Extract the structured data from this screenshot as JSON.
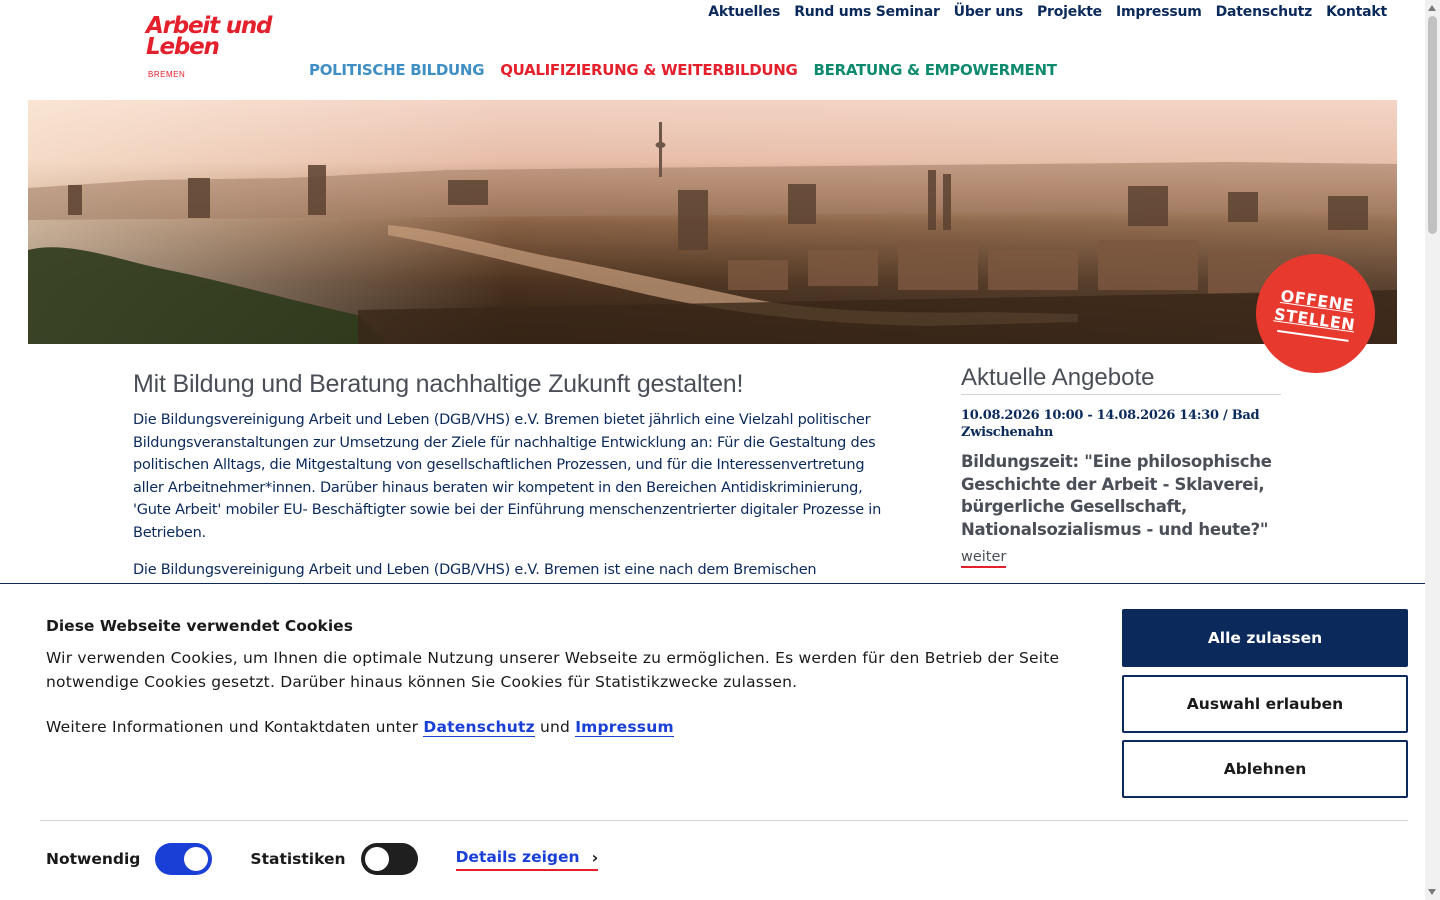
{
  "header": {
    "logo": {
      "line1": "Arbeit und",
      "line2": "Leben",
      "line3": "BREMEN"
    },
    "top_nav": [
      "Aktuelles",
      "Rund ums Seminar",
      "Über uns",
      "Projekte",
      "Impressum",
      "Datenschutz",
      "Kontakt"
    ],
    "main_nav": [
      {
        "label": "POLITISCHE BILDUNG",
        "color": "#3f8fc4"
      },
      {
        "label": "QUALIFIZIERUNG & WEITERBILDUNG",
        "color": "#e3202b"
      },
      {
        "label": "BERATUNG & EMPOWERMENT",
        "color": "#0e8a6e"
      }
    ]
  },
  "hero": {
    "badge_line1": "OFFENE",
    "badge_line2": "STELLEN",
    "badge_color": "#e8392f"
  },
  "main": {
    "title": "Mit Bildung und Beratung nachhaltige Zukunft gestalten!",
    "paragraph1": "Die Bildungsvereinigung Arbeit und Leben (DGB/VHS) e.V. Bremen bietet jährlich eine Vielzahl politischer Bildungsveranstaltungen zur Umsetzung der Ziele für nachhaltige Entwicklung an: Für die Gestaltung des politischen Alltags, die Mitgestaltung von gesellschaftlichen Prozessen, und für die Interessenvertretung aller Arbeitnehmer*innen. Darüber hinaus beraten wir kompetent in den Bereichen Antidiskriminierung, 'Gute Arbeit' mobiler EU- Beschäftigter sowie bei der Einführung menschenzentrierter digitaler Prozesse in Betrieben.",
    "paragraph2": "Die Bildungsvereinigung Arbeit und Leben (DGB/VHS) e.V. Bremen ist eine nach dem Bremischen"
  },
  "aside": {
    "heading": "Aktuelle Angebote",
    "date": "10.08.2026 10:00 - 14.08.2026 14:30 / Bad Zwischenahn",
    "title": "Bildungszeit: \"Eine philosophische Geschichte der Arbeit - Sklaverei, bürgerliche Gesellschaft, Nationalsozialismus - und heute?\"",
    "more": "weiter"
  },
  "cookie": {
    "heading": "Diese Webseite verwendet Cookies",
    "text": "Wir verwenden Cookies, um Ihnen die optimale Nutzung unserer Webseite zu ermöglichen. Es werden für den Betrieb der Seite notwendige Cookies gesetzt. Darüber hinaus können Sie Cookies für Statistikzwecke zulassen.",
    "info_prefix": "Weitere Informationen und Kontaktdaten unter",
    "info_link1": "Datenschutz",
    "info_and": "und",
    "info_link2": "Impressum",
    "btn_accept_all": "Alle zulassen",
    "btn_allow_selection": "Auswahl erlauben",
    "btn_reject": "Ablehnen",
    "toggle_necessary": {
      "label": "Notwendig",
      "on": true
    },
    "toggle_statistics": {
      "label": "Statistiken",
      "on": false
    },
    "details_link": "Details zeigen"
  }
}
